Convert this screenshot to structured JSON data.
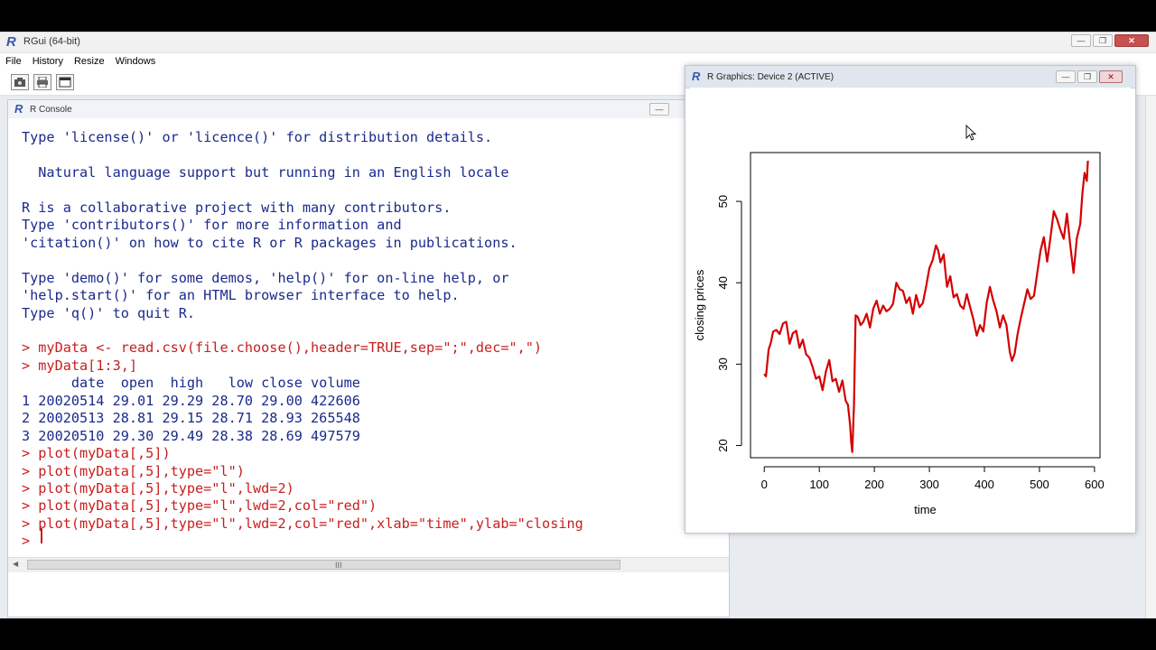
{
  "app": {
    "title": "RGui (64-bit)",
    "menu": [
      "File",
      "History",
      "Resize",
      "Windows"
    ]
  },
  "console": {
    "title": "R Console",
    "lines": [
      {
        "text": "Type 'license()' or 'licence()' for distribution details.",
        "kind": "out"
      },
      {
        "text": "",
        "kind": "out"
      },
      {
        "text": "  Natural language support but running in an English locale",
        "kind": "out"
      },
      {
        "text": "",
        "kind": "out"
      },
      {
        "text": "R is a collaborative project with many contributors.",
        "kind": "out"
      },
      {
        "text": "Type 'contributors()' for more information and",
        "kind": "out"
      },
      {
        "text": "'citation()' on how to cite R or R packages in publications.",
        "kind": "out"
      },
      {
        "text": "",
        "kind": "out"
      },
      {
        "text": "Type 'demo()' for some demos, 'help()' for on-line help, or",
        "kind": "out"
      },
      {
        "text": "'help.start()' for an HTML browser interface to help.",
        "kind": "out"
      },
      {
        "text": "Type 'q()' to quit R.",
        "kind": "out"
      },
      {
        "text": "",
        "kind": "out"
      },
      {
        "text": "> myData <- read.csv(file.choose(),header=TRUE,sep=\";\",dec=\",\")",
        "kind": "cmd"
      },
      {
        "text": "> myData[1:3,]",
        "kind": "cmd"
      },
      {
        "text": "      date  open  high   low close volume",
        "kind": "out"
      },
      {
        "text": "1 20020514 29.01 29.29 28.70 29.00 422606",
        "kind": "out"
      },
      {
        "text": "2 20020513 28.81 29.15 28.71 28.93 265548",
        "kind": "out"
      },
      {
        "text": "3 20020510 29.30 29.49 28.38 28.69 497579",
        "kind": "out"
      },
      {
        "text": "> plot(myData[,5])",
        "kind": "cmd"
      },
      {
        "text": "> plot(myData[,5],type=\"l\")",
        "kind": "cmd"
      },
      {
        "text": "> plot(myData[,5],type=\"l\",lwd=2)",
        "kind": "cmd"
      },
      {
        "text": "> plot(myData[,5],type=\"l\",lwd=2,col=\"red\")",
        "kind": "cmd"
      },
      {
        "text": "> plot(myData[,5],type=\"l\",lwd=2,col=\"red\",xlab=\"time\",ylab=\"closing",
        "kind": "cmd"
      },
      {
        "text": "> ",
        "kind": "cmd"
      }
    ],
    "scroll_grip": "III"
  },
  "graphics": {
    "title": "R Graphics: Device 2 (ACTIVE)"
  },
  "colors": {
    "line": "#d40000",
    "console_output": "#1a2a8c",
    "console_command": "#c81e1e"
  },
  "chart_data": {
    "type": "line",
    "xlabel": "time",
    "ylabel": "closing prices",
    "xlim": [
      -25,
      610
    ],
    "ylim": [
      18.5,
      56
    ],
    "xticks": [
      0,
      100,
      200,
      300,
      400,
      500,
      600
    ],
    "yticks": [
      20,
      30,
      40,
      50
    ],
    "grid": false,
    "series": [
      {
        "color": "#d40000",
        "x": [
          0,
          3,
          8,
          12,
          16,
          22,
          28,
          34,
          40,
          46,
          52,
          58,
          64,
          70,
          76,
          82,
          88,
          94,
          100,
          106,
          112,
          118,
          124,
          130,
          136,
          142,
          148,
          152,
          156,
          158,
          160,
          163,
          166,
          170,
          175,
          180,
          186,
          192,
          198,
          204,
          210,
          216,
          222,
          228,
          234,
          240,
          246,
          252,
          258,
          264,
          270,
          276,
          282,
          288,
          294,
          300,
          306,
          312,
          316,
          320,
          326,
          332,
          338,
          344,
          350,
          356,
          362,
          368,
          374,
          380,
          386,
          392,
          398,
          404,
          410,
          416,
          422,
          428,
          434,
          440,
          446,
          450,
          455,
          460,
          466,
          472,
          478,
          484,
          490,
          496,
          502,
          508,
          514,
          520,
          526,
          532,
          538,
          544,
          550,
          556,
          562,
          568,
          574,
          578,
          582,
          586,
          588
        ],
        "values": [
          28.8,
          28.5,
          31.8,
          32.6,
          34.0,
          34.2,
          33.7,
          35.0,
          35.2,
          32.5,
          33.8,
          34.1,
          32.0,
          33.0,
          31.2,
          30.8,
          29.6,
          28.2,
          28.5,
          26.8,
          29.1,
          30.5,
          27.9,
          28.2,
          26.6,
          28.0,
          25.5,
          25.0,
          22.5,
          20.4,
          19.2,
          25.0,
          36.0,
          35.8,
          34.8,
          35.2,
          36.2,
          34.5,
          36.8,
          37.8,
          36.2,
          37.2,
          36.5,
          36.8,
          37.4,
          40.0,
          39.2,
          39.0,
          37.5,
          38.2,
          36.2,
          38.5,
          37.0,
          37.5,
          39.5,
          41.8,
          42.8,
          44.6,
          44.0,
          42.5,
          43.5,
          39.5,
          40.8,
          38.2,
          38.6,
          37.2,
          36.8,
          38.6,
          37.0,
          35.5,
          33.5,
          34.8,
          34.0,
          37.5,
          39.5,
          37.8,
          36.5,
          34.5,
          36.0,
          34.8,
          31.5,
          30.4,
          31.3,
          33.6,
          35.6,
          37.4,
          39.2,
          38.0,
          38.4,
          41.2,
          44.0,
          45.6,
          42.6,
          45.5,
          48.8,
          47.8,
          46.5,
          45.4,
          48.5,
          44.6,
          41.2,
          45.5,
          47.2,
          51.0,
          53.5,
          52.5,
          55.0
        ]
      }
    ]
  }
}
